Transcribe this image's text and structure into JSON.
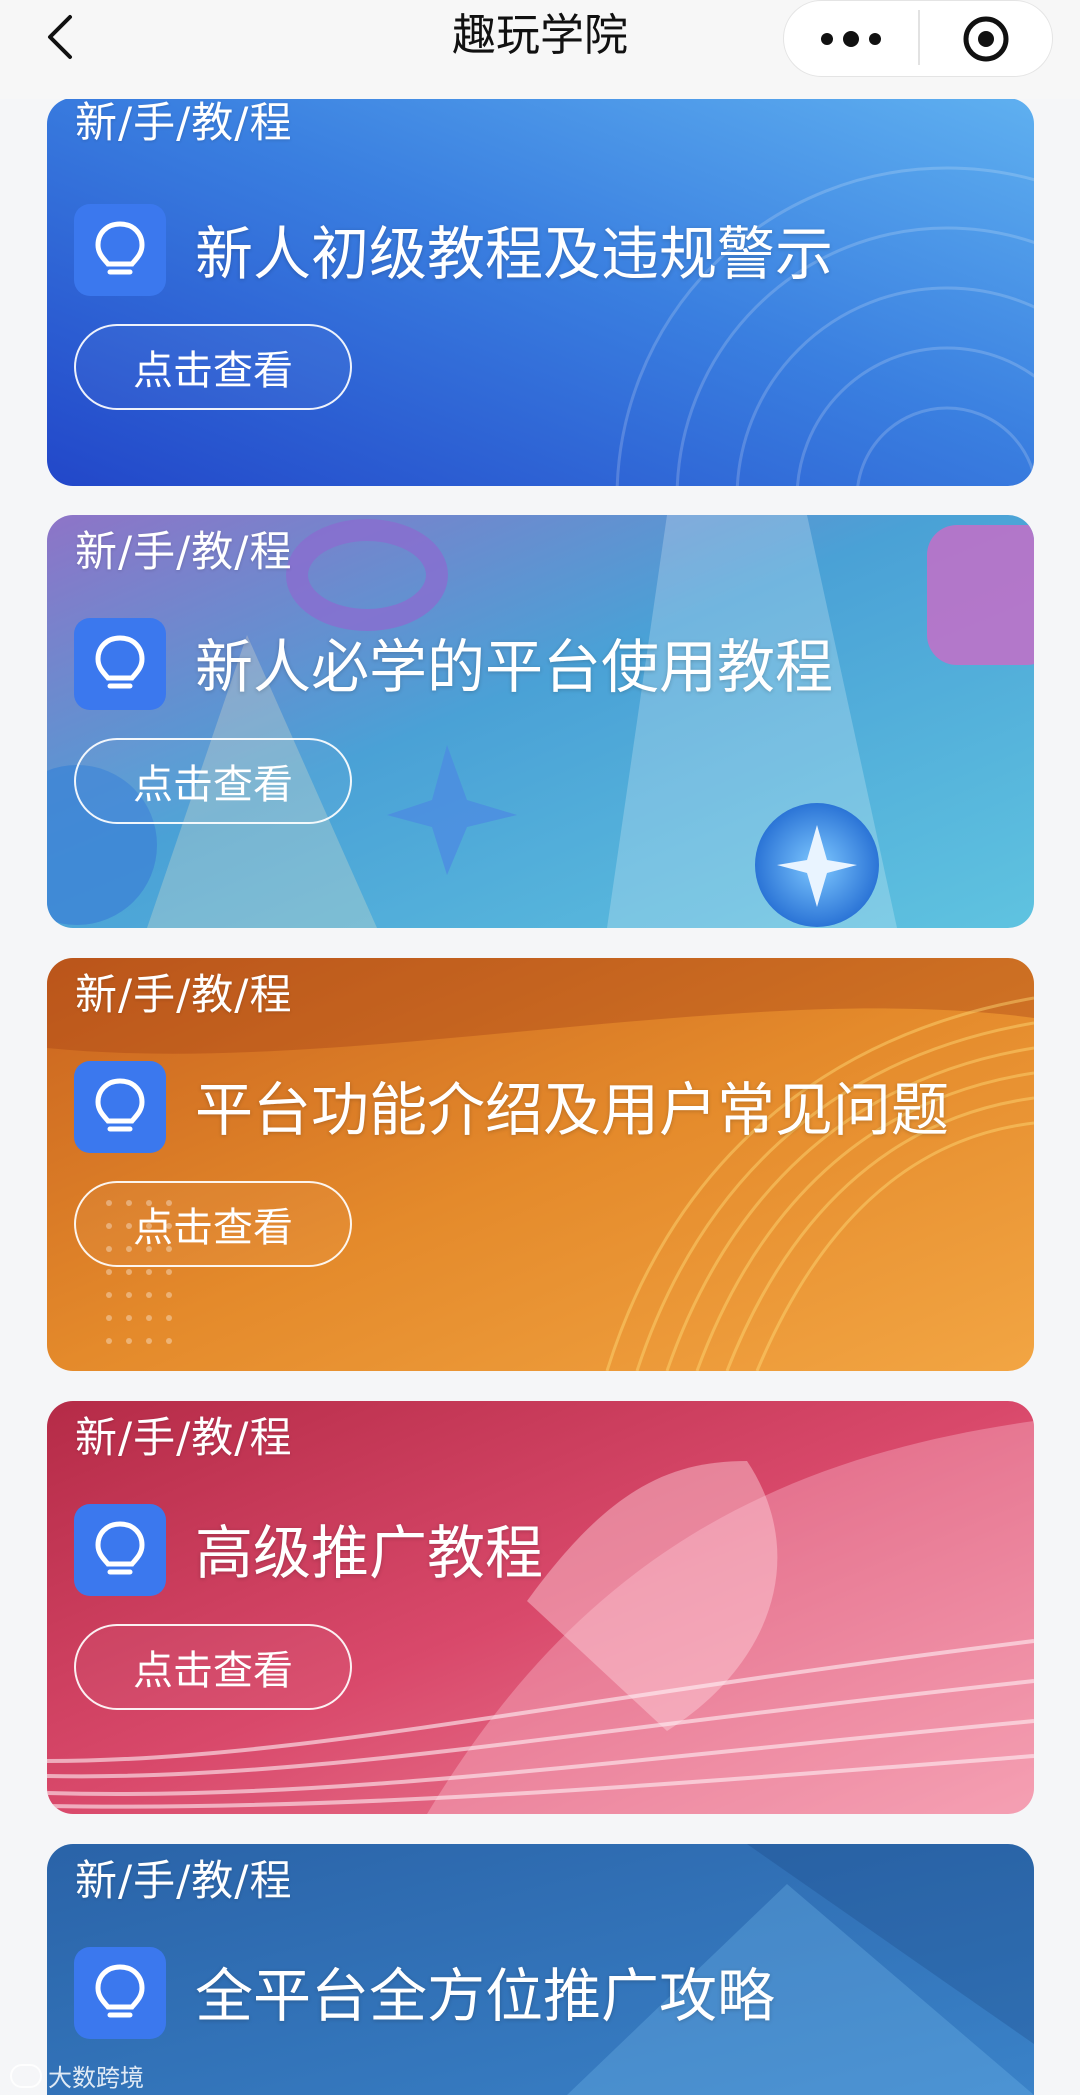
{
  "header": {
    "title": "趣玩学院"
  },
  "cards": [
    {
      "tag": "新/手/教/程",
      "title": "新人初级教程及违规警示",
      "button": "点击查看"
    },
    {
      "tag": "新/手/教/程",
      "title": "新人必学的平台使用教程",
      "button": "点击查看"
    },
    {
      "tag": "新/手/教/程",
      "title": "平台功能介绍及用户常见问题",
      "button": "点击查看"
    },
    {
      "tag": "新/手/教/程",
      "title": "高级推广教程",
      "button": "点击查看"
    },
    {
      "tag": "新/手/教/程",
      "title": "全平台全方位推广攻略",
      "button": ""
    }
  ],
  "watermark": "大数跨境",
  "colors": {
    "card1": "#2f5fd8",
    "card2": "#5aa6d8",
    "card3": "#e38a2a",
    "card4": "#d24a6a",
    "card5": "#2f6fb3",
    "badge": "#3b78ee"
  },
  "icons": [
    "back-chevron-icon",
    "more-dots-icon",
    "close-target-icon",
    "lightbulb-icon"
  ]
}
